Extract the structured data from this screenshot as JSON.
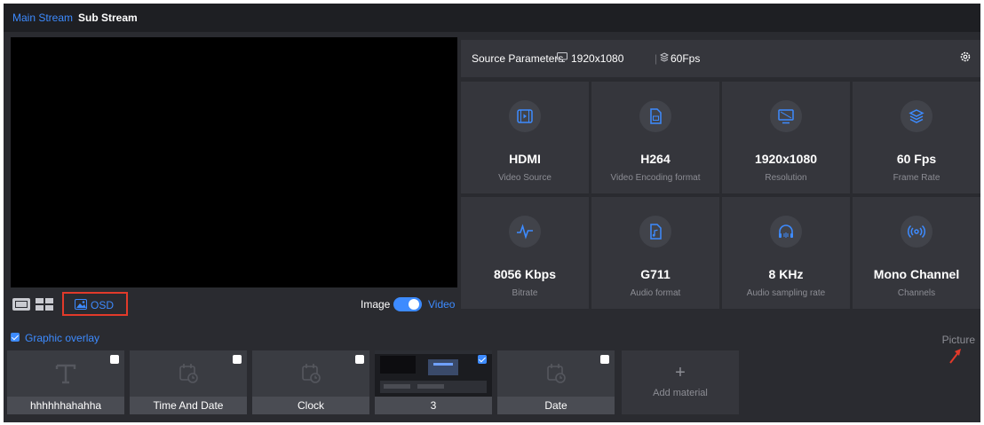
{
  "tabs": [
    {
      "label": "Main Stream",
      "active": true
    },
    {
      "label": "Sub Stream",
      "active": false
    }
  ],
  "controls": {
    "osd_label": "OSD",
    "image_label": "Image",
    "video_label": "Video",
    "toggle_on": true
  },
  "params": {
    "title": "Source Parameters",
    "resolution": "1920x1080",
    "fps": "60Fps",
    "separator": "|",
    "cards": [
      {
        "value": "HDMI",
        "label": "Video Source",
        "icon": "video-source-icon"
      },
      {
        "value": "H264",
        "label": "Video Encoding format",
        "icon": "encoding-file-icon"
      },
      {
        "value": "1920x1080",
        "label": "Resolution",
        "icon": "monitor-icon"
      },
      {
        "value": "60 Fps",
        "label": "Frame Rate",
        "icon": "layers-icon"
      },
      {
        "value": "8056 Kbps",
        "label": "Bitrate",
        "icon": "pulse-icon"
      },
      {
        "value": "G711",
        "label": "Audio format",
        "icon": "audio-file-icon"
      },
      {
        "value": "8 KHz",
        "label": "Audio sampling rate",
        "icon": "headphones-icon"
      },
      {
        "value": "Mono Channel",
        "label": "Channels",
        "icon": "broadcast-icon"
      }
    ]
  },
  "overlay": {
    "title": "Graphic overlay",
    "checked": true,
    "picture_label": "Picture",
    "tiles": [
      {
        "name": "hhhhhhahahha",
        "checked": false,
        "kind": "text"
      },
      {
        "name": "Time And Date",
        "checked": false,
        "kind": "calendar"
      },
      {
        "name": "Clock",
        "checked": false,
        "kind": "calendar"
      },
      {
        "name": "3",
        "checked": true,
        "kind": "image"
      },
      {
        "name": "Date",
        "checked": false,
        "kind": "calendar"
      }
    ],
    "add_label": "Add material",
    "add_symbol": "+"
  },
  "colors": {
    "accent": "#3d8bff",
    "panel": "#2a2b30",
    "card": "#35363c",
    "highlight": "#e23a2a"
  }
}
